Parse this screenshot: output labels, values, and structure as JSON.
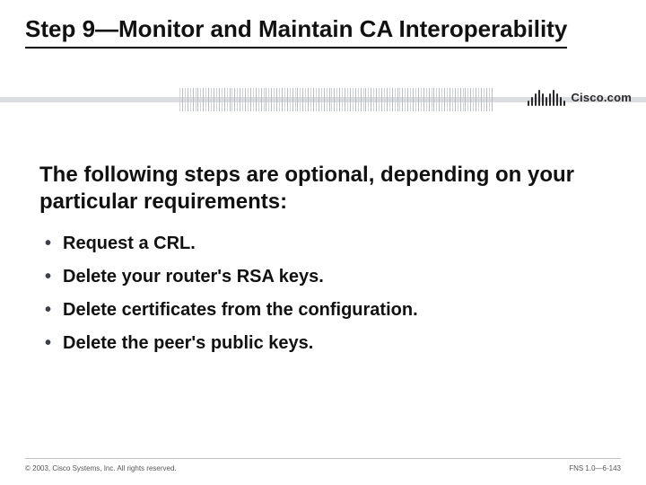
{
  "title": "Step 9—Monitor and Maintain CA Interoperability",
  "lead": "The following steps are optional, depending on your particular requirements:",
  "bullets": [
    "Request a CRL.",
    "Delete your router's RSA keys.",
    "Delete certificates from the configuration.",
    "Delete the peer's public keys."
  ],
  "logo": {
    "text": "Cisco.com"
  },
  "footer": {
    "left": "© 2003, Cisco Systems, Inc. All rights reserved.",
    "right": "FNS 1.0—6-143"
  }
}
